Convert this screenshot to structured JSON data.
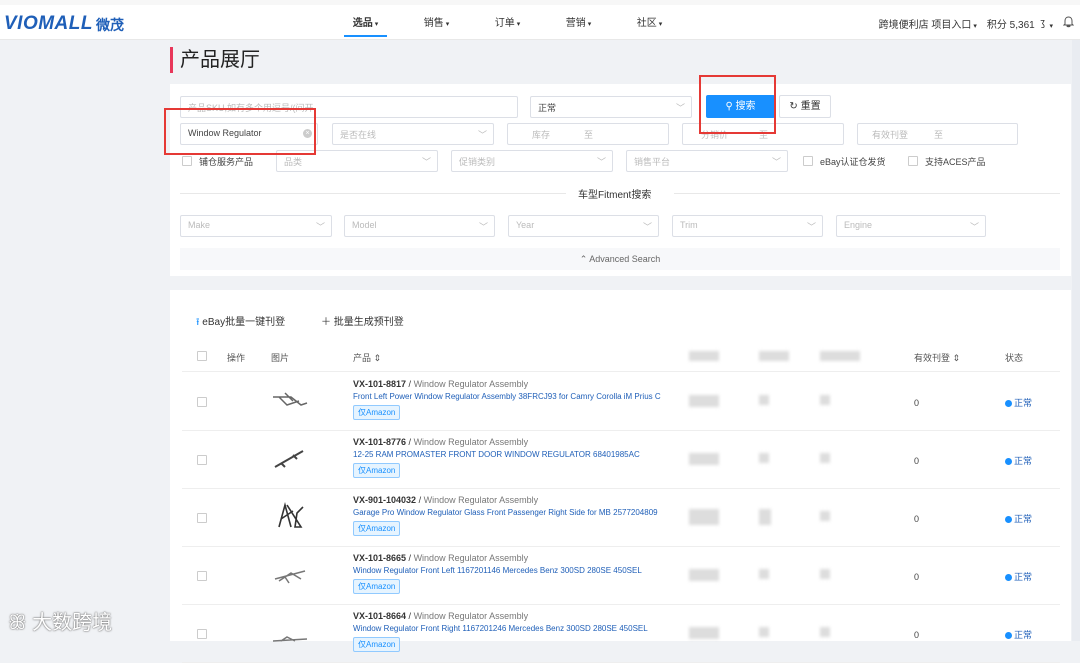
{
  "header": {
    "logo": "VIOMALL",
    "logo_cn": "微茂",
    "nav": [
      {
        "label": "选品",
        "active": true
      },
      {
        "label": "销售",
        "active": false
      },
      {
        "label": "订单",
        "active": false
      },
      {
        "label": "营销",
        "active": false
      },
      {
        "label": "社区",
        "active": false
      }
    ],
    "store": "跨境便利店 项目入口",
    "points": "积分 5,361"
  },
  "page": {
    "title": "产品展厅"
  },
  "filters": {
    "sku_placeholder": "产品SKU,如有多个用逗号/(间开",
    "status_value": "正常",
    "search_btn": "搜索",
    "reset_btn": "重置",
    "keyword_value": "Window Regulator",
    "online_placeholder": "是否在线",
    "stock_placeholder": "库存",
    "range_sep": "至",
    "sales_placeholder": "分销价",
    "listing_placeholder": "有效刊登",
    "warehouse_label": "铺仓服务产品",
    "category_placeholder": "品类",
    "promo_placeholder": "促销类别",
    "platform_placeholder": "销售平台",
    "ebay_label": "eBay认证仓发货",
    "aces_label": "支持ACES产品",
    "fitment_title": "车型Fitment搜索",
    "make": "Make",
    "model": "Model",
    "year": "Year",
    "trim": "Trim",
    "engine": "Engine",
    "advanced": "Advanced Search"
  },
  "toolbar": {
    "ebay_batch": "eBay批量一键刊登",
    "batch_generate": "批量生成预刊登"
  },
  "table": {
    "headers": {
      "op": "操作",
      "image": "图片",
      "product": "产品",
      "listing": "有效刊登",
      "status": "状态"
    },
    "rows": [
      {
        "sku": "VX-101-8817",
        "category": "Window Regulator Assembly",
        "title": "Front Left Power Window Regulator Assembly 38FRCJ93 for Camry Corolla iM Prius C",
        "tag": "仅Amazon",
        "count": "0",
        "status": "正常"
      },
      {
        "sku": "VX-101-8776",
        "category": "Window Regulator Assembly",
        "title": "12-25 RAM PROMASTER FRONT DOOR WINDOW REGULATOR 68401985AC",
        "tag": "仅Amazon",
        "count": "0",
        "status": "正常"
      },
      {
        "sku": "VX-901-104032",
        "category": "Window Regulator Assembly",
        "title": "Garage Pro Window Regulator Glass Front Passenger Right Side for MB 2577204809",
        "tag": "仅Amazon",
        "count": "0",
        "status": "正常"
      },
      {
        "sku": "VX-101-8665",
        "category": "Window Regulator Assembly",
        "title": "Window Regulator Front Left 1167201146 Mercedes Benz 300SD 280SE 450SEL",
        "tag": "仅Amazon",
        "count": "0",
        "status": "正常"
      },
      {
        "sku": "VX-101-8664",
        "category": "Window Regulator Assembly",
        "title": "Window Regulator Front Right 1167201246 Mercedes Benz 300SD 280SE 450SEL",
        "tag": "仅Amazon",
        "count": "0",
        "status": "正常"
      }
    ]
  },
  "watermark": "大数跨境"
}
